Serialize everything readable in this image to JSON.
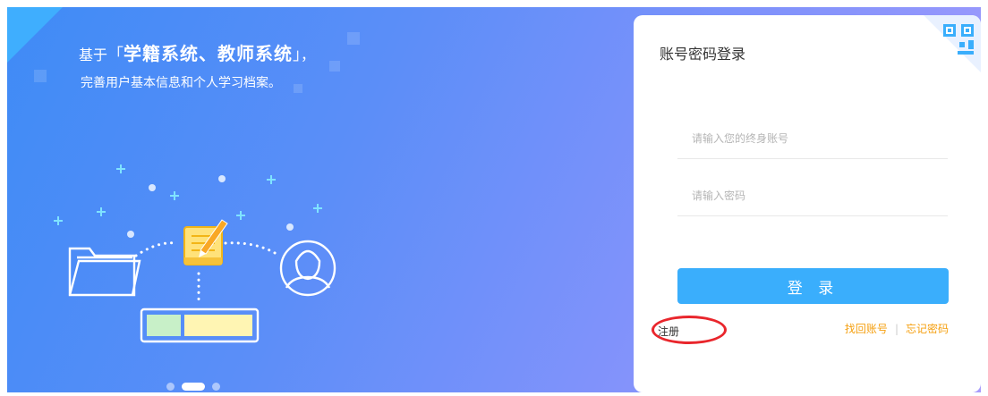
{
  "banner": {
    "headline_prefix": "基于",
    "headline_bracket_open": "「",
    "headline_bold": "学籍系统、教师系统",
    "headline_bracket_close": "」",
    "headline_suffix": "，",
    "subline": "完善用户基本信息和个人学习档案。",
    "carousel_count": 3,
    "carousel_active": 1
  },
  "login": {
    "title": "账号密码登录",
    "account_placeholder": "请输入您的终身账号",
    "password_placeholder": "请输入密码",
    "login_button": "登 录",
    "register_link": "注册",
    "find_account_link": "找回账号",
    "separator": "|",
    "forgot_password_link": "忘记密码"
  },
  "colors": {
    "primary": "#3aaefc",
    "link": "#f5a011",
    "highlight_circle": "#e9262c"
  }
}
